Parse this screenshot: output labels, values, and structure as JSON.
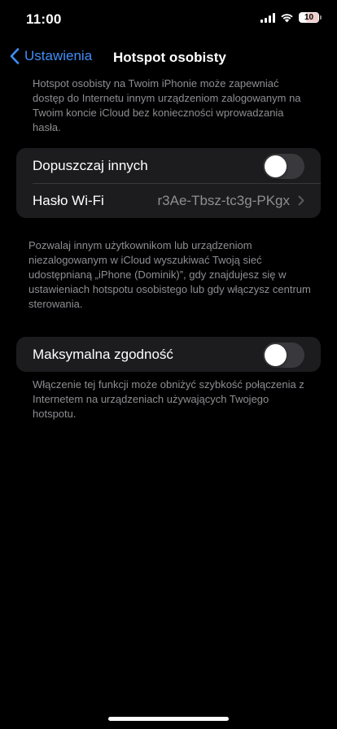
{
  "status_bar": {
    "time": "11:00",
    "battery_level": "10",
    "icons": [
      "cellular-signal-icon",
      "wifi-icon",
      "battery-icon"
    ]
  },
  "nav": {
    "back_label": "Ustawienia",
    "title": "Hotspot osobisty"
  },
  "header_info": "Hotspot osobisty na Twoim iPhonie może zapewniać dostęp do Internetu innym urządzeniom zalogowanym na Twoim koncie iCloud bez konieczności wprowadzania hasła.",
  "group1": {
    "allow_others": {
      "label": "Dopuszczaj innych",
      "enabled": false
    },
    "wifi_password": {
      "label": "Hasło Wi-Fi",
      "value": "r3Ae-Tbsz-tc3g-PKgx"
    }
  },
  "group1_footer": "Pozwalaj innym użytkownikom lub urządzeniom niezalogowanym w iCloud wyszukiwać Twoją sieć udostępnianą „iPhone (Dominik)”, gdy znajdujesz się w ustawieniach hotspotu osobistego lub gdy włączysz centrum sterowania.",
  "group2": {
    "max_compat": {
      "label": "Maksymalna zgodność",
      "enabled": false
    }
  },
  "group2_footer": "Włączenie tej funkcji może obniżyć szybkość połączenia z Internetem na urządzeniach używających Twojego hotspotu.",
  "colors": {
    "background": "#000000",
    "cell": "#1c1c1e",
    "accent": "#3f8ef7",
    "secondary_text": "#8e8e93",
    "toggle_off": "#39393d"
  }
}
